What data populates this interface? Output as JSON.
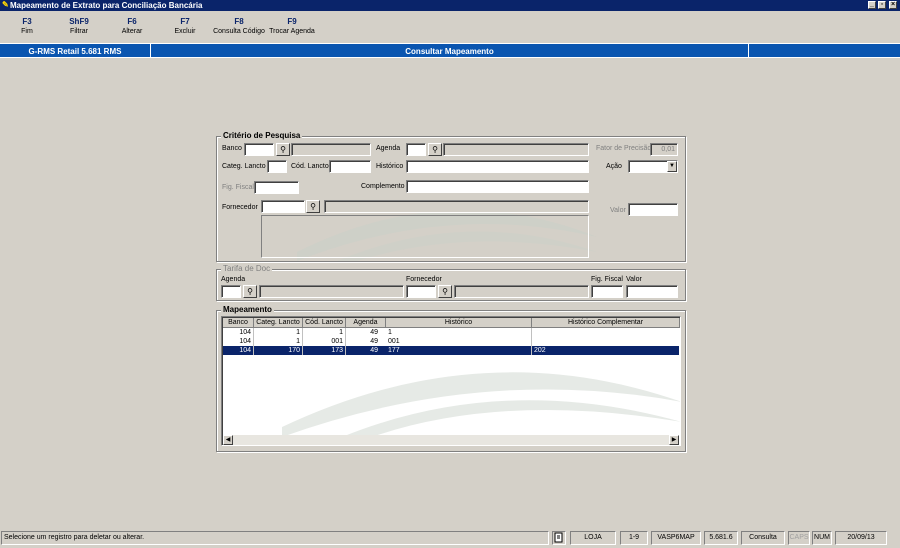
{
  "window": {
    "title": "Mapeamento de Extrato para Conciliação Bancária",
    "icon": "app-icon"
  },
  "toolbar": [
    {
      "key": "F3",
      "label": "Fim"
    },
    {
      "key": "ShF9",
      "label": "Filtrar"
    },
    {
      "key": "F6",
      "label": "Alterar"
    },
    {
      "key": "F7",
      "label": "Excluir"
    },
    {
      "key": "F8",
      "label": "Consulta Código"
    },
    {
      "key": "F9",
      "label": "Trocar Agenda"
    }
  ],
  "header": {
    "product": "G-RMS Retail 5.681 RMS",
    "screen": "Consultar Mapeamento"
  },
  "criteria": {
    "title": "Critério de Pesquisa",
    "banco": "Banco",
    "agenda": "Agenda",
    "fator_precisao": "Fator de Precisão",
    "fator_precisao_value": "0,01",
    "categ_lancto": "Categ. Lancto",
    "cod_lancto": "Cód. Lancto",
    "historico": "Histórico",
    "acao": "Ação",
    "fig_fiscal": "Fig. Fiscal",
    "complemento": "Complemento",
    "fornecedor": "Fornecedor",
    "valor": "Valor"
  },
  "tarifa": {
    "title": "Tarifa de Doc",
    "agenda": "Agenda",
    "fornecedor": "Fornecedor",
    "fig_fiscal": "Fig. Fiscal",
    "valor": "Valor"
  },
  "mapeamento": {
    "title": "Mapeamento",
    "columns": [
      "Banco",
      "Categ. Lancto",
      "Cód. Lancto",
      "Agenda",
      "Histórico",
      "Histórico Complementar"
    ],
    "rows": [
      [
        "104",
        "1",
        "1",
        "49",
        "1",
        ""
      ],
      [
        "104",
        "1",
        "001",
        "49",
        "001",
        ""
      ],
      [
        "104",
        "170",
        "173",
        "49",
        "177",
        "202"
      ]
    ]
  },
  "statusbar": {
    "message": "Selecione um registro para deletar ou alterar.",
    "loja": "LOJA",
    "range": "1-9",
    "program": "VASP6MAP",
    "version": "5.681.6",
    "mode": "Consulta",
    "caps": "CAPS",
    "num": "NUM",
    "date": "20/09/13"
  }
}
